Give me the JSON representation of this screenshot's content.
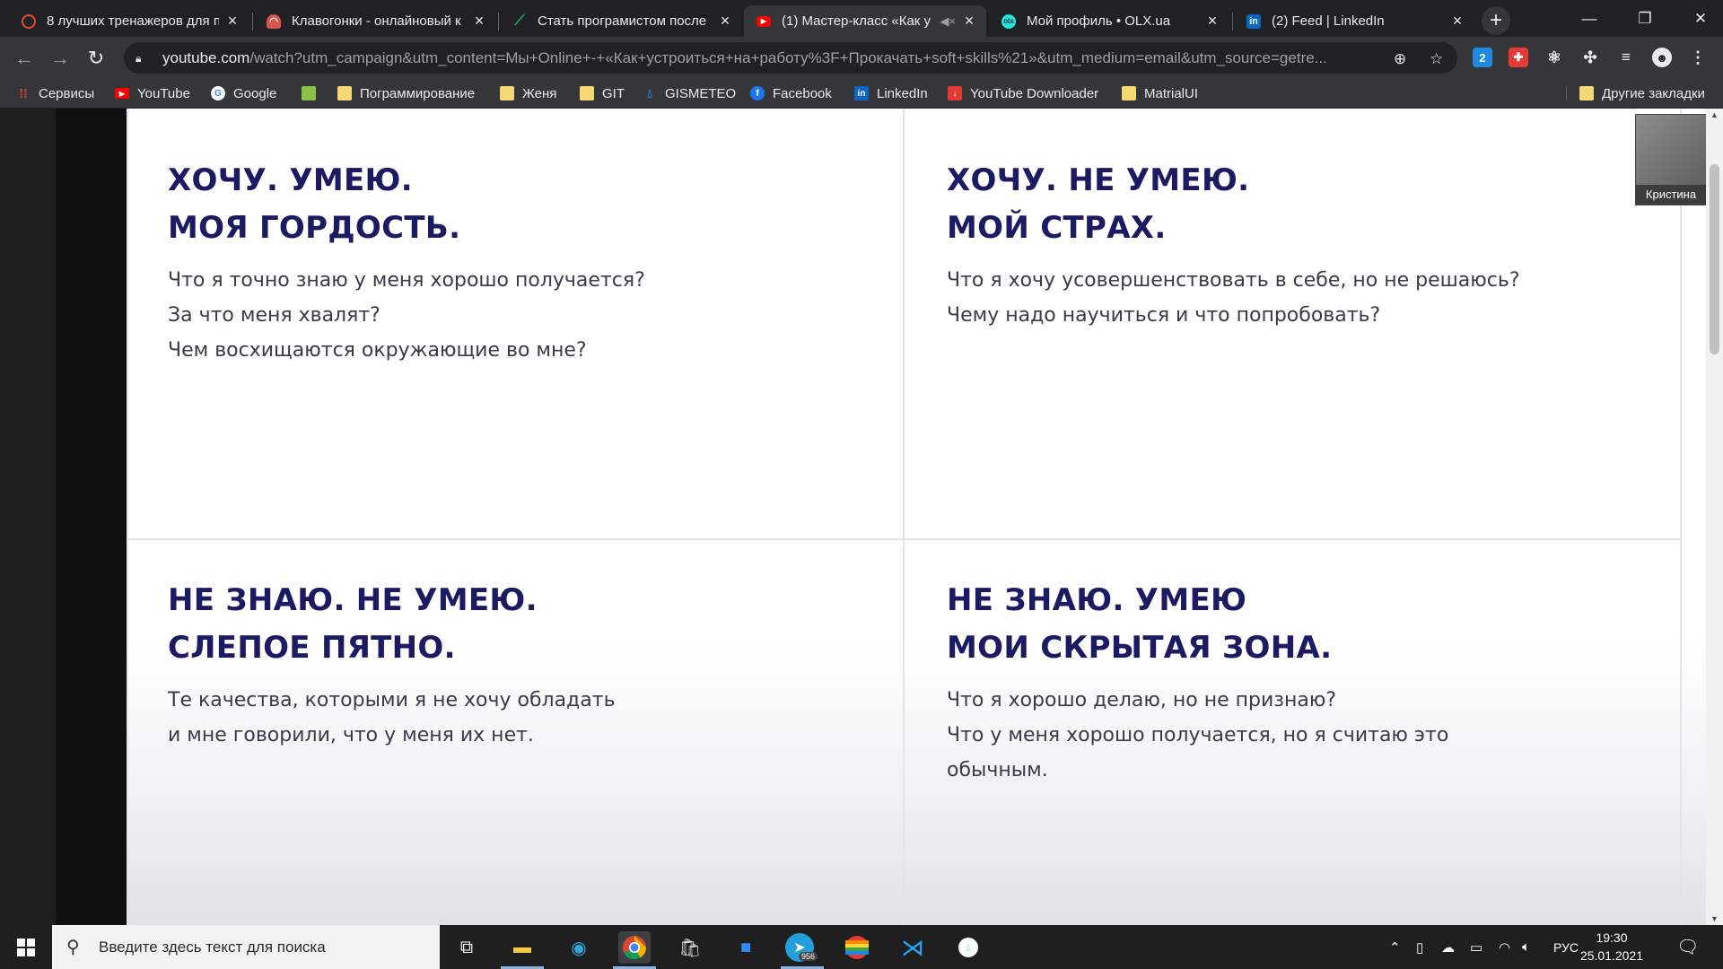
{
  "browser": {
    "tabs": [
      {
        "title": "8 лучших тренажеров для п",
        "active": false,
        "icon": "codeguida-icon",
        "color": "#e8453c"
      },
      {
        "title": "Клавогонки - онлайновый к",
        "active": false,
        "icon": "klavogonki-icon",
        "color": "#d9534f"
      },
      {
        "title": "Стать програмистом после",
        "active": false,
        "icon": "leaf-icon",
        "color": "#34a853"
      },
      {
        "title": "(1) Мастер-класс «Как у",
        "active": true,
        "icon": "youtube-icon",
        "color": "#ff0000"
      },
      {
        "title": "Мой профиль • OLX.ua",
        "active": false,
        "icon": "olx-icon",
        "color": "#23e5db"
      },
      {
        "title": "(2) Feed | LinkedIn",
        "active": false,
        "icon": "linkedin-icon",
        "color": "#0a66c2"
      }
    ],
    "new_tab": "+",
    "window": {
      "minimize": "—",
      "restore": "❐",
      "close": "✕"
    },
    "url_host": "youtube.com",
    "url_rest": "/watch?utm_campaign&utm_content=Мы+Online+-+«Как+устроиться+на+работу%3F+Прокачать+soft+skills%21»&utm_medium=email&utm_source=getre...",
    "bookmarks": [
      {
        "label": "Сервисы",
        "icon": "apps-grid-icon",
        "color": "#4285f4"
      },
      {
        "label": "YouTube",
        "icon": "youtube-icon",
        "color": "#ff0000"
      },
      {
        "label": "Google",
        "icon": "google-icon",
        "color": "#ffffff"
      },
      {
        "label": "",
        "icon": "image-icon",
        "color": "#8bc34a"
      },
      {
        "label": "Пограммирование",
        "icon": "folder-icon",
        "color": "#f7d774"
      },
      {
        "label": "Женя",
        "icon": "folder-icon",
        "color": "#f7d774"
      },
      {
        "label": "GIT",
        "icon": "folder-icon",
        "color": "#f7d774"
      },
      {
        "label": "GISMETEO",
        "icon": "gismeteo-icon",
        "color": "#2f7de1"
      },
      {
        "label": "Facebook",
        "icon": "facebook-icon",
        "color": "#1877f2"
      },
      {
        "label": "LinkedIn",
        "icon": "linkedin-icon",
        "color": "#0a66c2"
      },
      {
        "label": "YouTube Downloader",
        "icon": "download-icon",
        "color": "#e53935"
      },
      {
        "label": "MatrialUI",
        "icon": "folder-icon",
        "color": "#f7d774"
      }
    ],
    "other_bookmarks": "Другие закладки"
  },
  "slide": {
    "quadrants": [
      {
        "title_line1": "ХОЧУ. УМЕЮ.",
        "title_line2": "МОЯ ГОРДОСТЬ.",
        "lines": [
          "Что я точно знаю у меня хорошо получается?",
          "За что меня хвалят?",
          "Чем восхищаются окружающие во мне?"
        ]
      },
      {
        "title_line1": "ХОЧУ. НЕ УМЕЮ.",
        "title_line2": "МОЙ СТРАХ.",
        "lines": [
          "Что я хочу усовершенствовать в себе, но не решаюсь?",
          "Чему надо научиться и что попробовать?"
        ]
      },
      {
        "title_line1": "НЕ ЗНАЮ. НЕ УМЕЮ.",
        "title_line2": "СЛЕПОЕ ПЯТНО.",
        "lines": [
          "Те качества, которыми я не хочу обладать",
          "и мне говорили, что у меня их нет."
        ]
      },
      {
        "title_line1": "НЕ ЗНАЮ. УМЕЮ",
        "title_line2": "МОИ СКРЫТАЯ ЗОНА.",
        "lines": [
          "Что я хорошо делаю, но не признаю?",
          "Что у меня хорошо получается, но я считаю это",
          "обычным."
        ]
      }
    ],
    "heading_color": "#1c1a63"
  },
  "participant": {
    "name": "Кристина"
  },
  "taskbar": {
    "search_placeholder": "Введите здесь текст для поиска",
    "telegram_badge": "956",
    "language": "РУС",
    "time": "19:30",
    "date": "25.01.2021"
  }
}
